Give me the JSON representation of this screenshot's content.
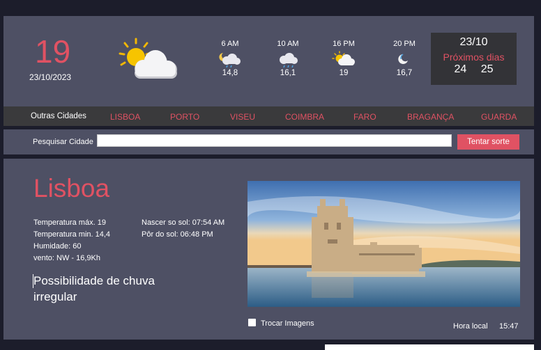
{
  "current": {
    "temperature": "19",
    "date": "23/10/2023",
    "icon": "partly-cloudy-day-icon"
  },
  "hourly": [
    {
      "time": "6 AM",
      "temp": "14,8",
      "icon": "night-cloud-drizzle-icon"
    },
    {
      "time": "10 AM",
      "temp": "16,1",
      "icon": "cloud-drizzle-icon"
    },
    {
      "time": "16 PM",
      "temp": "19",
      "icon": "partly-cloudy-day-icon"
    },
    {
      "time": "20 PM",
      "temp": "16,7",
      "icon": "moon-icon"
    }
  ],
  "next_days": {
    "date": "23/10",
    "label": "Próximos dias",
    "days": [
      "24",
      "25"
    ]
  },
  "cities": {
    "label": "Outras Cidades",
    "items": [
      "LISBOA",
      "PORTO",
      "VISEU",
      "COIMBRA",
      "FARO",
      "BRAGANÇA",
      "GUARDA"
    ]
  },
  "search": {
    "label": "Pesquisar Cidade",
    "value": "",
    "button": "Tentar sorte"
  },
  "main": {
    "city": "Lisboa",
    "max_temp": "Temperatura máx. 19",
    "min_temp": "Temperatura min.  14,4",
    "humidity": "Humidade: 60",
    "wind": "vento: NW - 16,9Kh",
    "sunrise": "Nascer so sol: 07:54 AM",
    "sunset": "Pôr do sol: 06:48 PM",
    "rain": "Possibilidade de chuva irregular",
    "swap_images_label": "Trocar Imagens",
    "swap_images_checked": false,
    "local_time_label": "Hora local",
    "local_time": "15:47"
  },
  "colors": {
    "accent": "#e05263",
    "panel": "#4e5064",
    "background": "#1c1d2b",
    "dark_bar": "#3a3a3c"
  }
}
